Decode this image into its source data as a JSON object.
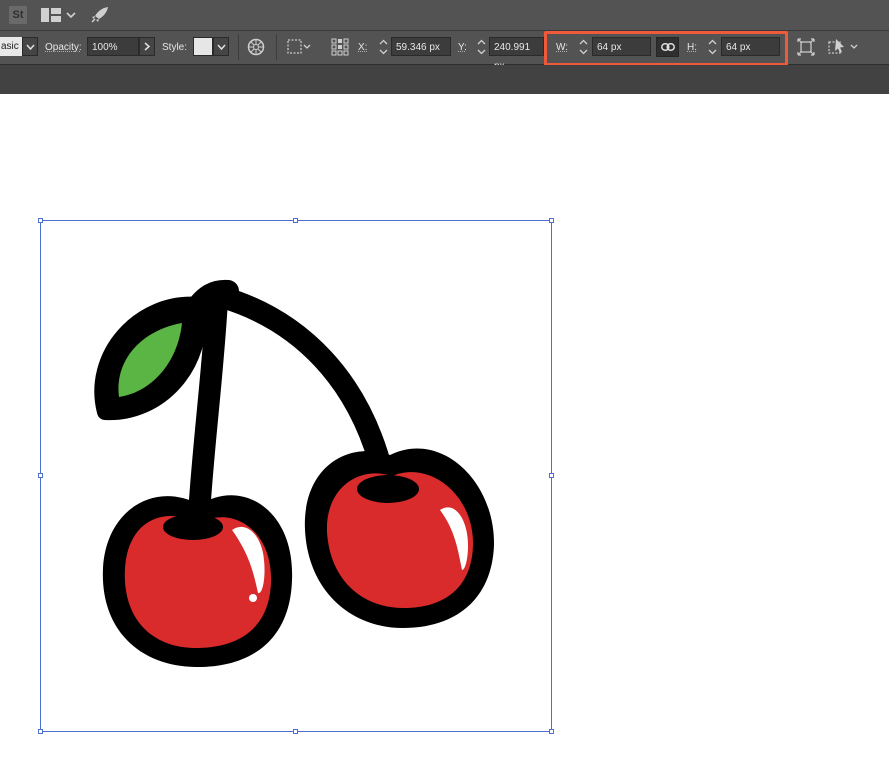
{
  "app": {
    "stock_badge": "St"
  },
  "control": {
    "mode_label": "asic",
    "opacity_label": "Opacity:",
    "opacity_value": "100%",
    "style_label": "Style:",
    "x_label": "X:",
    "x_value": "59.346 px",
    "y_label": "Y:",
    "y_value": "240.991 px",
    "w_label": "W:",
    "w_value": "64 px",
    "h_label": "H:",
    "h_value": "64 px"
  },
  "colors": {
    "highlight": "#f05a3a",
    "selection": "#4d6fd0",
    "cherry_red": "#d92b2b",
    "leaf_green": "#5ab544",
    "outline": "#000000"
  },
  "icons": {
    "toolbar": [
      "stock-icon",
      "workspace-layout-icon",
      "chevron-down-icon",
      "rocket-icon"
    ],
    "control": [
      "recolor-icon",
      "select-similar-icon",
      "align-grid-icon",
      "constrain-link-icon",
      "transform-icon",
      "isolate-icon"
    ]
  }
}
